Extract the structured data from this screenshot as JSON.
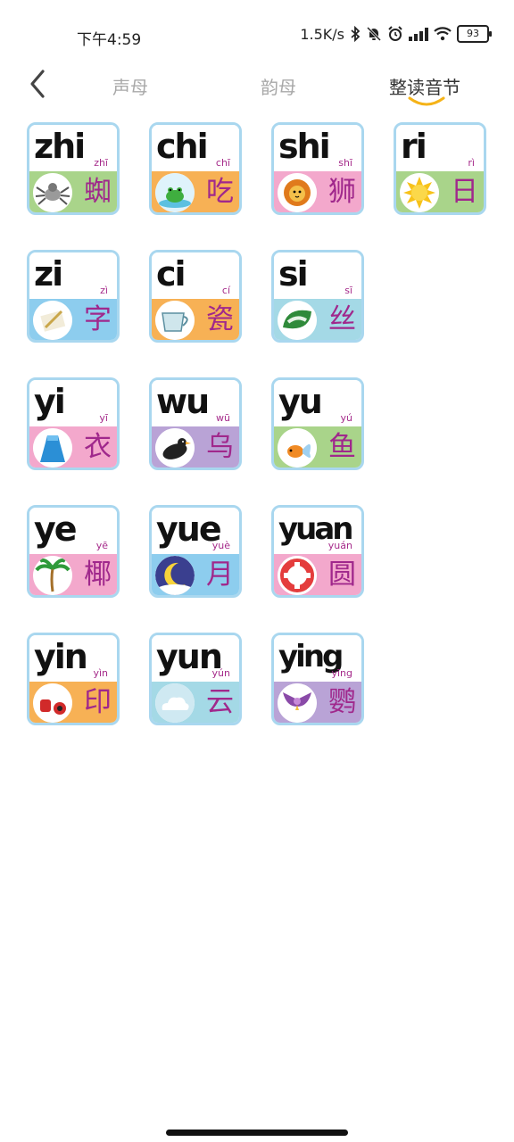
{
  "status_bar": {
    "time": "下午4:59",
    "network_speed": "1.5K/s",
    "battery": "93"
  },
  "nav": {
    "tabs": [
      {
        "label": "声母"
      },
      {
        "label": "韵母"
      },
      {
        "label": "整读音节"
      }
    ],
    "active_tab": "整读音节"
  },
  "cards": [
    {
      "pinyin": "zhi",
      "tone": "zhī",
      "hanzi": "蜘",
      "picture": "spider-icon",
      "color": "#a9d48a"
    },
    {
      "pinyin": "chi",
      "tone": "chī",
      "hanzi": "吃",
      "picture": "frog-eating-icon",
      "color": "#f7b155"
    },
    {
      "pinyin": "shi",
      "tone": "shī",
      "hanzi": "狮",
      "picture": "lion-icon",
      "color": "#f3a8cc"
    },
    {
      "pinyin": "ri",
      "tone": "rì",
      "hanzi": "日",
      "picture": "sun-icon",
      "color": "#a9d48a"
    },
    {
      "pinyin": "zi",
      "tone": "zì",
      "hanzi": "字",
      "picture": "writing-icon",
      "color": "#8dcdee"
    },
    {
      "pinyin": "ci",
      "tone": "cí",
      "hanzi": "瓷",
      "picture": "cup-icon",
      "color": "#f7b155"
    },
    {
      "pinyin": "si",
      "tone": "sī",
      "hanzi": "丝",
      "picture": "silkworm-leaf-icon",
      "color": "#a4d9e6"
    },
    {
      "pinyin": "yi",
      "tone": "yī",
      "hanzi": "衣",
      "picture": "dress-icon",
      "color": "#f3a8cc"
    },
    {
      "pinyin": "wu",
      "tone": "wū",
      "hanzi": "乌",
      "picture": "crow-icon",
      "color": "#b9a3d6"
    },
    {
      "pinyin": "yu",
      "tone": "yú",
      "hanzi": "鱼",
      "picture": "fish-icon",
      "color": "#a9d48a"
    },
    {
      "pinyin": "ye",
      "tone": "yē",
      "hanzi": "椰",
      "picture": "palm-tree-icon",
      "color": "#f3a8cc"
    },
    {
      "pinyin": "yue",
      "tone": "yuè",
      "hanzi": "月",
      "picture": "moon-icon",
      "color": "#8dcdee"
    },
    {
      "pinyin": "yuan",
      "tone": "yuán",
      "hanzi": "圆",
      "picture": "lifebuoy-icon",
      "color": "#f3a8cc"
    },
    {
      "pinyin": "yin",
      "tone": "yìn",
      "hanzi": "印",
      "picture": "stamp-icon",
      "color": "#f7b155"
    },
    {
      "pinyin": "yun",
      "tone": "yún",
      "hanzi": "云",
      "picture": "cloud-icon",
      "color": "#a4d9e6"
    },
    {
      "pinyin": "ying",
      "tone": "yīng",
      "hanzi": "鹦",
      "picture": "parrot-icon",
      "color": "#b9a3d6"
    }
  ]
}
